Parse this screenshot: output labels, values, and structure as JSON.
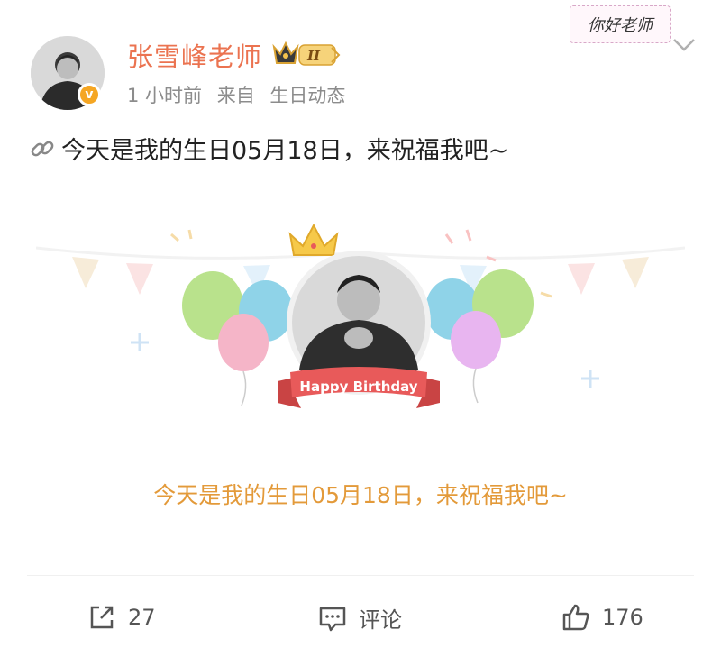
{
  "post": {
    "author": "张雪峰老师",
    "vip_level": "II",
    "time": "1 小时前",
    "source_prefix": "来自",
    "source": "生日动态",
    "sticker_text": "你好老师",
    "text": "今天是我的生日05月18日，来祝福我吧~"
  },
  "card": {
    "banner_text": "Happy Birthday",
    "caption": "今天是我的生日05月18日，来祝福我吧~"
  },
  "actions": {
    "share_count": "27",
    "comment_label": "评论",
    "like_count": "176"
  },
  "colors": {
    "username": "#eb7350",
    "caption": "#e39a3a",
    "ribbon": "#e85a5a"
  }
}
